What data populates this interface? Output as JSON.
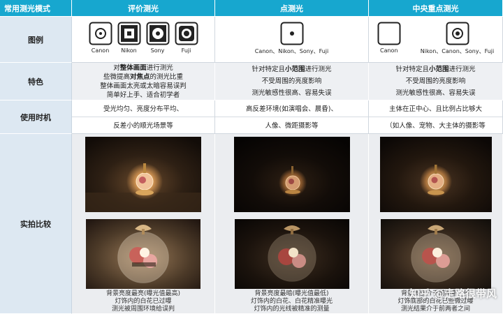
{
  "header": {
    "mode": "常用测光模式",
    "evaluative": "评价测光",
    "spot": "点测光",
    "center": "中央重点测光"
  },
  "rows": {
    "legend": "图例",
    "features": "特色",
    "timing": "使用时机",
    "compare": "实拍比较"
  },
  "legend": {
    "evaluative": [
      "Canon",
      "Nikon",
      "Sony",
      "Fuji"
    ],
    "spot": "Canon、Nikon、Sony、Fuji",
    "center": [
      "Canon",
      "Nikon、Canon、Sony、Fuji"
    ]
  },
  "features": {
    "evaluative": {
      "l1_pre": "对",
      "l1_bold": "整体画面",
      "l1_post": "进行测光",
      "l2_pre": "些微提高",
      "l2_bold": "对焦点",
      "l2_post": "的测光比重",
      "l3": "整体画面太亮或太暗容易误判",
      "l4": "简单好上手、适合初学者"
    },
    "spot": {
      "l1_pre": "针对特定且",
      "l1_bold": "小范围",
      "l1_post": "进行测光",
      "l2": "不受周围的亮度影响",
      "l3": "测光敏感性很高、容易失误"
    },
    "center": {
      "l1_pre": "针对特定且",
      "l1_bold": "小范围",
      "l1_post": "进行测光",
      "l2": "不受周围的亮度影响",
      "l3": "测光敏感性很高、容易失误"
    }
  },
  "timing": {
    "evaluative": [
      "受光均匀、亮度分布平均、",
      "反差小的顺光场景等"
    ],
    "spot": [
      "高反差环境(如演唱会、晨昏)、",
      "人像、微距摄影等"
    ],
    "center": [
      "主体在正中心、且比例占比够大",
      "（如人像、宠物、大主体的摄影等"
    ]
  },
  "captions": {
    "evaluative": [
      "背景亮度最亮(曝光值最高)",
      "灯饰内的白花已过曝",
      "测光被周围环境给误判"
    ],
    "spot": [
      "背景亮度最暗(曝光值最低)",
      "灯饰内的白花、白花精准曝光",
      "灯饰内的光线被精准的测量"
    ],
    "center": [
      "背景亮度介于前两者之间",
      "灯饰底部的白花已些微过曝",
      "测光结果介于前两者之间"
    ]
  },
  "watermark": "知乎 @走路很带风",
  "colors": {
    "header": "#17a7cf",
    "rowhead": "#dde8f2",
    "grey": "#eef0f3"
  },
  "icons": [
    "canon-evaluative-icon",
    "nikon-matrix-icon",
    "sony-multi-icon",
    "fuji-multi-icon",
    "spot-metering-icon",
    "canon-center-weighted-icon",
    "center-weighted-icon"
  ]
}
